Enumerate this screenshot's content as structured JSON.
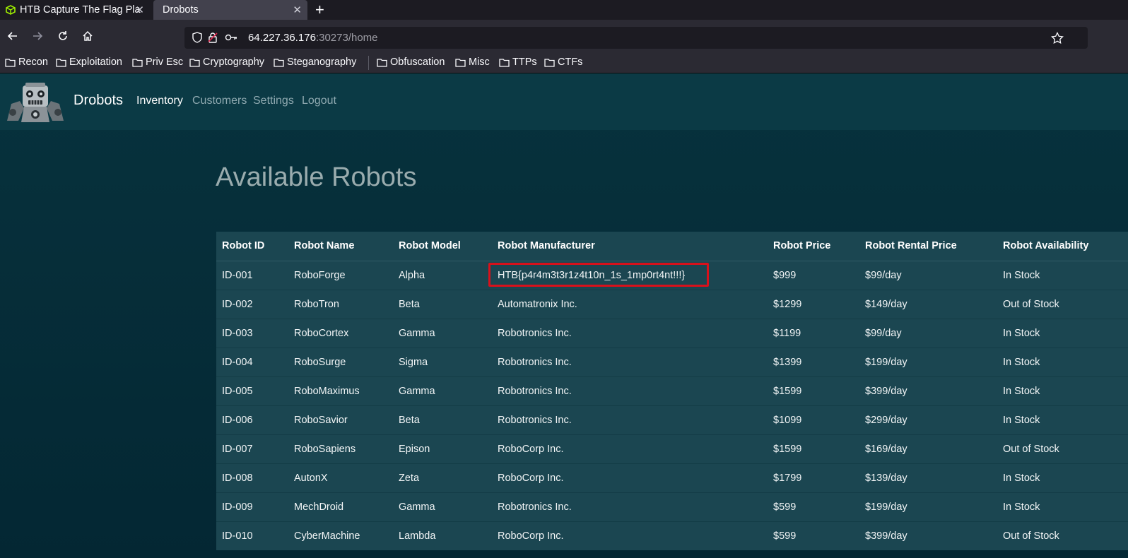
{
  "browser": {
    "tabs": [
      {
        "title": "HTB Capture The Flag Pla"
      },
      {
        "title": "Drobots"
      }
    ],
    "url_host": "64.227.36.176",
    "url_path": ":30273/home",
    "bookmarks": [
      "Recon",
      "Exploitation",
      "Priv Esc",
      "Cryptography",
      "Steganography",
      "Obfuscation",
      "Misc",
      "TTPs",
      "CTFs"
    ]
  },
  "site": {
    "brand": "Drobots",
    "nav": [
      "Inventory",
      "Customers",
      "Settings",
      "Logout"
    ],
    "active_nav": "Inventory"
  },
  "main": {
    "heading": "Available Robots",
    "columns": [
      "Robot ID",
      "Robot Name",
      "Robot Model",
      "Robot Manufacturer",
      "Robot Price",
      "Robot Rental Price",
      "Robot Availability"
    ],
    "rows": [
      [
        "ID-001",
        "RoboForge",
        "Alpha",
        "HTB{p4r4m3t3r1z4t10n_1s_1mp0rt4nt!!!}",
        "$999",
        "$99/day",
        "In Stock"
      ],
      [
        "ID-002",
        "RoboTron",
        "Beta",
        "Automatronix Inc.",
        "$1299",
        "$149/day",
        "Out of Stock"
      ],
      [
        "ID-003",
        "RoboCortex",
        "Gamma",
        "Robotronics Inc.",
        "$1199",
        "$99/day",
        "In Stock"
      ],
      [
        "ID-004",
        "RoboSurge",
        "Sigma",
        "Robotronics Inc.",
        "$1399",
        "$199/day",
        "In Stock"
      ],
      [
        "ID-005",
        "RoboMaximus",
        "Gamma",
        "Robotronics Inc.",
        "$1599",
        "$399/day",
        "In Stock"
      ],
      [
        "ID-006",
        "RoboSavior",
        "Beta",
        "Robotronics Inc.",
        "$1099",
        "$299/day",
        "In Stock"
      ],
      [
        "ID-007",
        "RoboSapiens",
        "Epison",
        "RoboCorp Inc.",
        "$1599",
        "$169/day",
        "Out of Stock"
      ],
      [
        "ID-008",
        "AutonX",
        "Zeta",
        "RoboCorp Inc.",
        "$1799",
        "$139/day",
        "In Stock"
      ],
      [
        "ID-009",
        "MechDroid",
        "Gamma",
        "Robotronics Inc.",
        "$599",
        "$199/day",
        "In Stock"
      ],
      [
        "ID-010",
        "CyberMachine",
        "Lambda",
        "RoboCorp Inc.",
        "$599",
        "$399/day",
        "Out of Stock"
      ]
    ]
  },
  "colors": {
    "highlight": "#d8111b",
    "page_bg": "#042733",
    "table_bg": "#1b4651"
  },
  "icons": [
    "htb-cube-icon",
    "close-icon",
    "plus-icon",
    "back-arrow-icon",
    "forward-arrow-icon",
    "reload-icon",
    "home-icon",
    "shield-icon",
    "lock-slash-icon",
    "key-icon",
    "star-icon",
    "folder-icon",
    "robot-logo"
  ]
}
